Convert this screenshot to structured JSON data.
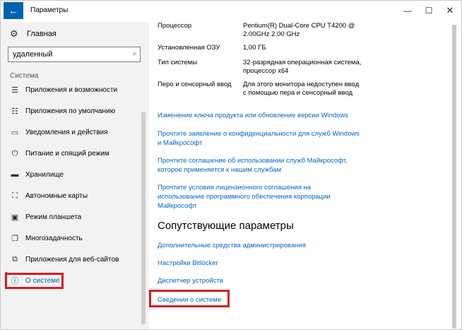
{
  "window": {
    "title": "Параметры",
    "back_icon": "←",
    "minimize": "—",
    "maximize": "☐",
    "close": "✕"
  },
  "sidebar": {
    "home_label": "Главная",
    "search_value": "удаленный",
    "section_label": "Система",
    "items": [
      {
        "label": "Приложения и возможности",
        "icon": "apps-list-icon"
      },
      {
        "label": "Приложения по умолчанию",
        "icon": "default-apps-icon"
      },
      {
        "label": "Уведомления и действия",
        "icon": "notifications-icon"
      },
      {
        "label": "Питание и спящий режим",
        "icon": "power-icon"
      },
      {
        "label": "Хранилище",
        "icon": "storage-icon"
      },
      {
        "label": "Автономные карты",
        "icon": "map-icon"
      },
      {
        "label": "Режим планшета",
        "icon": "tablet-icon"
      },
      {
        "label": "Многозадачность",
        "icon": "multitask-icon"
      },
      {
        "label": "Приложения для веб-сайтов",
        "icon": "web-apps-icon"
      },
      {
        "label": "О системе",
        "icon": "info-icon"
      }
    ]
  },
  "specs": [
    {
      "key": "Процессор",
      "value": "Pentium(R) Dual-Core CPU      T4200 @ 2.00GHz   2.00 GHz"
    },
    {
      "key": "Установленная ОЗУ",
      "value": "1,00 ГБ"
    },
    {
      "key": "Тип системы",
      "value": "32-разрядная операционная система, процессор x64"
    },
    {
      "key": "Перо и сенсорный ввод",
      "value": "Для этого монитора недоступен ввод с помощью пера и сенсорный ввод"
    }
  ],
  "links": [
    "Изменение ключа продукта или обновление версии Windows",
    "Прочтите заявление о конфиденциальности для служб Windows и Майкрософт",
    "Прочтите соглашение об использовании служб Майкрософт, которое применяется к нашим службам",
    "Прочтите условия лицензионного соглашения на использование программного обеспечения корпорации Майкрософт"
  ],
  "related": {
    "heading": "Сопутствующие параметры",
    "links": [
      "Дополнительные средства администрирования",
      "Настройки Bitlocker",
      "Диспетчер устройств",
      "Сведения о системе"
    ]
  },
  "colors": {
    "accent": "#0063b1",
    "link": "#0066cc",
    "highlight": "#d51b22"
  }
}
